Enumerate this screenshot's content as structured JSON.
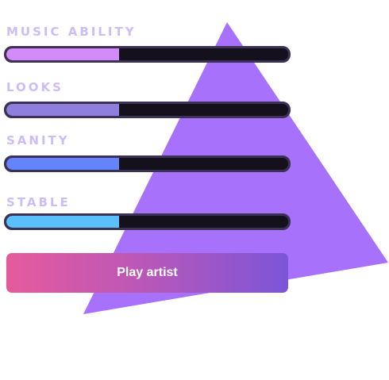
{
  "colors": {
    "triangle": "#a771fb",
    "label": "#cdbdf7",
    "track": "#14101c",
    "track_border": "#3c3156"
  },
  "stats": [
    {
      "label": "MUSIC ABILITY",
      "level": 0.4,
      "color": "#d58af9"
    },
    {
      "label": "LOOKS",
      "level": 0.4,
      "color": "#8f7fdc"
    },
    {
      "label": "SANITY",
      "level": 0.4,
      "color": "#6384fb"
    },
    {
      "label": "STABLE",
      "level": 0.4,
      "color": "#5abffb"
    }
  ],
  "action": {
    "label": "Play artist"
  }
}
